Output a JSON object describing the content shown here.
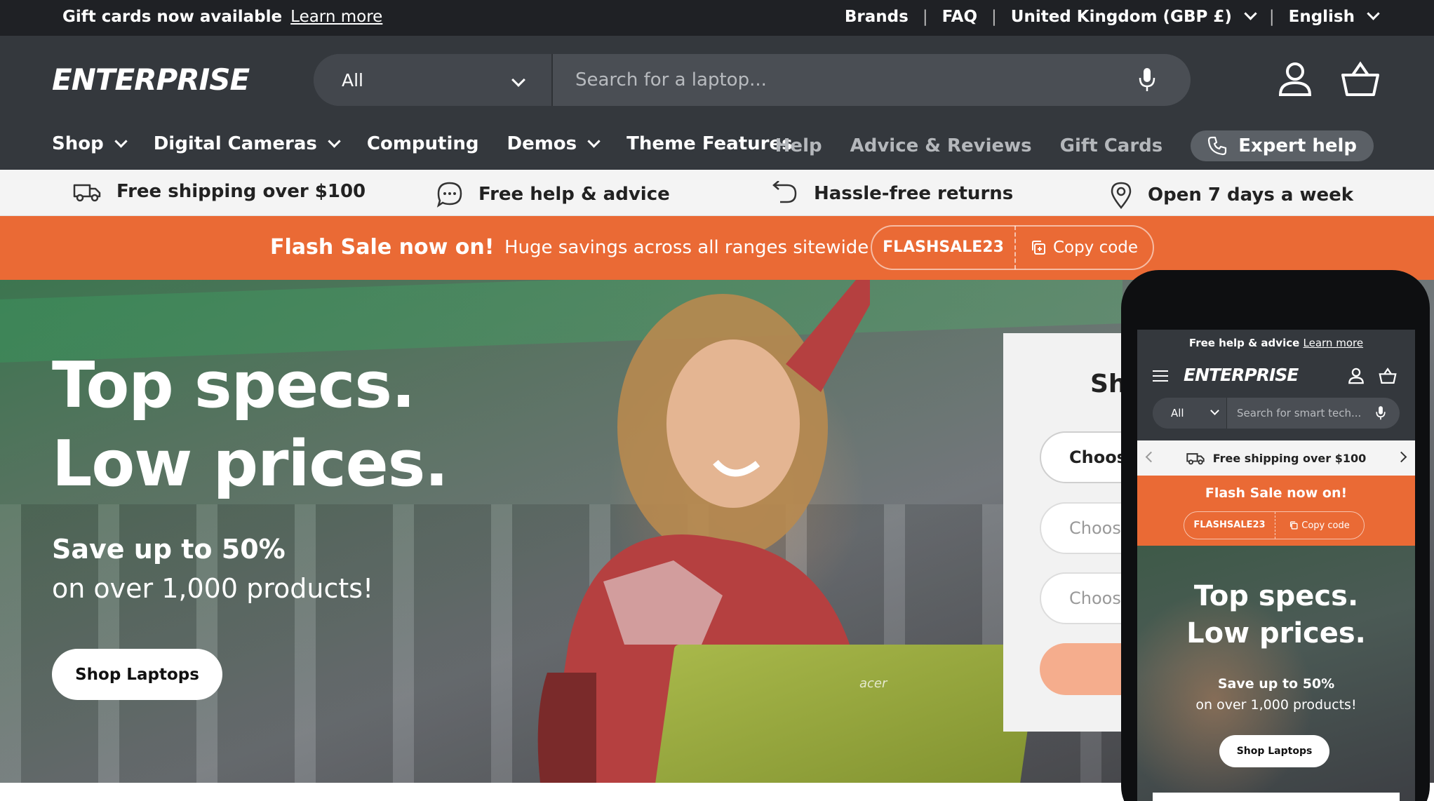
{
  "announcement": {
    "text": "Gift cards now available",
    "link": "Learn more"
  },
  "utility_nav": {
    "brands": "Brands",
    "faq": "FAQ",
    "country": "United Kingdom (GBP £)",
    "language": "English"
  },
  "header": {
    "logo": "ENTERPRISE",
    "search_category": "All",
    "search_placeholder": "Search for a laptop..."
  },
  "main_nav": {
    "shop": "Shop",
    "digital_cameras": "Digital Cameras",
    "computing": "Computing",
    "demos": "Demos",
    "theme_features": "Theme Features"
  },
  "secondary_nav": {
    "help": "Help",
    "advice": "Advice & Reviews",
    "gift_cards": "Gift Cards",
    "expert_help": "Expert help"
  },
  "usp": {
    "shipping": "Free shipping over $100",
    "help": "Free help & advice",
    "returns": "Hassle-free returns",
    "open": "Open 7 days a week"
  },
  "flash": {
    "title": "Flash Sale now on!",
    "subtitle": "Huge savings across all ranges sitewide",
    "code": "FLASHSALE23",
    "copy": "Copy code"
  },
  "hero": {
    "title_line1": "Top specs.",
    "title_line2": "Low prices.",
    "save": "Save up to 50%",
    "sub": "on over 1,000 products!",
    "button": "Shop Laptops",
    "laptop_brand": "acer"
  },
  "finder": {
    "title": "Sh",
    "select1": "Choose",
    "select2": "Choose",
    "select3": "Choose"
  },
  "mobile": {
    "top_text": "Free help & advice",
    "top_link": "Learn more",
    "logo": "ENTERPRISE",
    "search_category": "All",
    "search_placeholder": "Search for smart tech...",
    "usp": "Free shipping over $100",
    "flash_title": "Flash Sale now on!",
    "code": "FLASHSALE23",
    "copy": "Copy code",
    "hero_line1": "Top specs.",
    "hero_line2": "Low prices.",
    "save": "Save up to 50%",
    "sub": "on over 1,000 products!",
    "button": "Shop Laptops"
  },
  "colors": {
    "accent": "#ea6a35",
    "header": "#34383d",
    "topbar": "#1f2125"
  }
}
